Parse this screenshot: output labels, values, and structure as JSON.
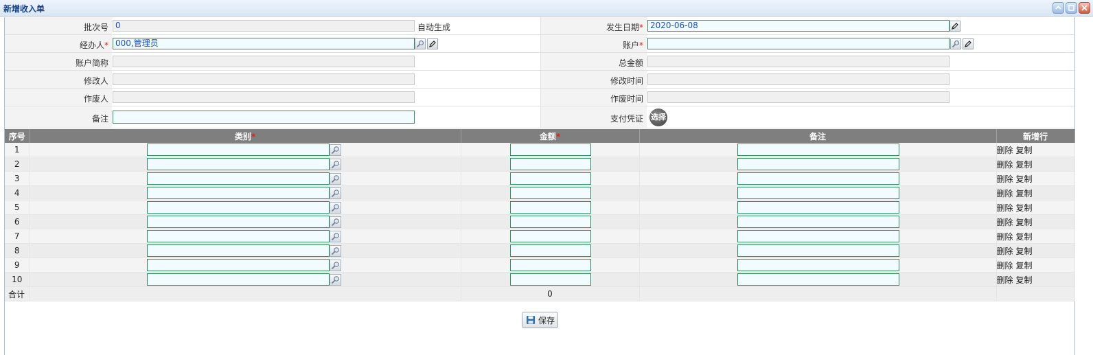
{
  "window": {
    "title": "新增收入单"
  },
  "form": {
    "batch_label": "批次号",
    "batch_value": "0",
    "batch_hint": "自动生成",
    "date_label": "发生日期",
    "date_value": "2020-06-08",
    "handler_label": "经办人",
    "handler_value": "000,管理员",
    "account_label": "账户",
    "account_value": "",
    "account_short_label": "账户简称",
    "total_label": "总金额",
    "modifier_label": "修改人",
    "modify_time_label": "修改时间",
    "voider_label": "作废人",
    "void_time_label": "作废时间",
    "remark_label": "备注",
    "voucher_label": "支付凭证",
    "voucher_button": "选择",
    "required_mark": "*"
  },
  "table": {
    "headers": {
      "index": "序号",
      "category": "类别",
      "amount": "金额",
      "remark": "备注",
      "new_row": "新增行"
    },
    "rows": [
      "1",
      "2",
      "3",
      "4",
      "5",
      "6",
      "7",
      "8",
      "9",
      "10"
    ],
    "delete_label": "删除",
    "copy_label": "复制",
    "total_label": "合计",
    "total_amount": "0"
  },
  "footer": {
    "save_label": "保存"
  },
  "icons": {
    "lookup": "magnifier-icon",
    "edit": "pencil-icon",
    "save": "floppy-disk-icon"
  },
  "colors": {
    "title": "#15428b",
    "header_bg": "#7f7f7f",
    "input_border": "#2d8f5e",
    "required": "#e0201a"
  }
}
